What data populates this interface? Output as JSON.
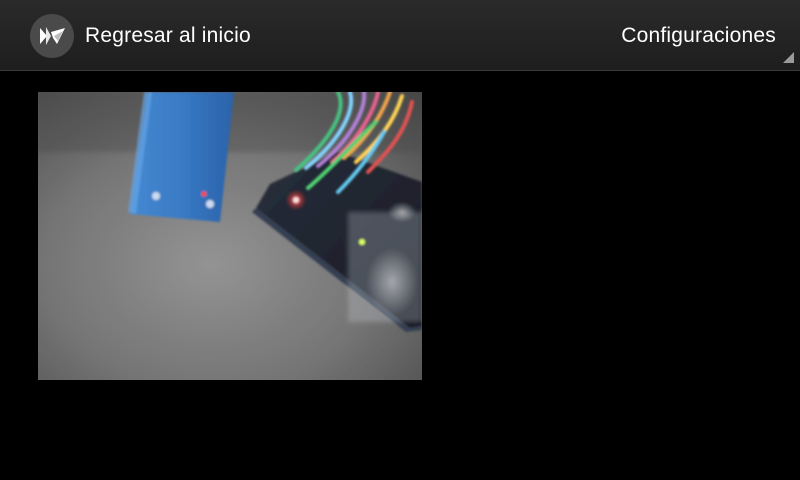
{
  "action_bar": {
    "back_label": "Regresar al inicio",
    "app_icon": "kivy-logo-icon",
    "settings_label": "Configuraciones",
    "overflow_icon": "corner-triangle-icon"
  },
  "camera": {
    "content": "camera-preview-image"
  },
  "colors": {
    "background": "#000000",
    "action_bar": "#262626",
    "text": "#ffffff"
  }
}
